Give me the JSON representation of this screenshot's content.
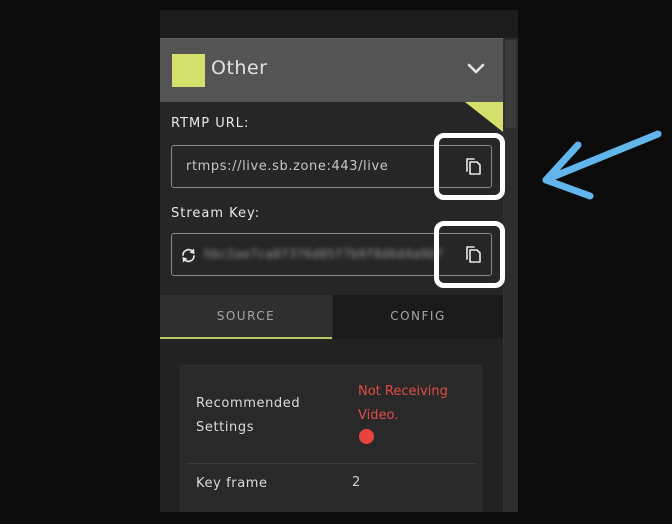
{
  "platform": {
    "name": "Other",
    "swatch_color": "#d4e06b"
  },
  "rtmp": {
    "label": "RTMP URL:",
    "value": "rtmps://live.sb.zone:443/live"
  },
  "stream_key": {
    "label": "Stream Key:",
    "value": "hbc2ae7ca8f376d05f7b9f8d6d4a9b7"
  },
  "tabs": [
    {
      "label": "SOURCE",
      "active": true
    },
    {
      "label": "CONFIG",
      "active": false
    }
  ],
  "settings": {
    "recommended_label": "Recommended Settings",
    "status_text": "Not Receiving Video.",
    "status_color": "#e24b44",
    "keyframe_label": "Key frame",
    "keyframe_value": "2"
  },
  "annotation": {
    "highlight_color": "#ffffff",
    "arrow_color": "#62b6ec"
  },
  "icons": [
    "chevron-down-icon",
    "copy-icon",
    "refresh-icon"
  ]
}
